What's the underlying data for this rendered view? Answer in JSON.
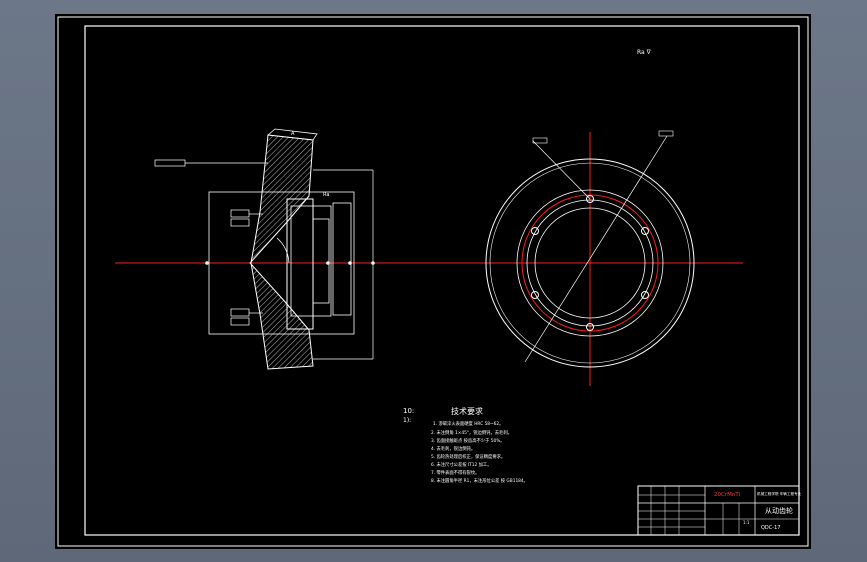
{
  "drawing": {
    "roughness_mark": "Ra",
    "datum_box": "A",
    "notes_roman": "10:",
    "notes_marker": "1):",
    "notes_title": "技术要求",
    "notes": [
      "1. 渗碳淬火表面硬度 HRC 58~62。",
      "2. 未注倒角 1×45°，锐边倒钝，去毛刺。",
      "3. 齿面接触斑点 按齿高不少于 50%。",
      "4. 去毛刺，锐边倒钝。",
      "5. 齿轮热处理后校正，保证精度要求。",
      "6. 未注尺寸公差按 IT12 加工。",
      "7. 零件表面不得有裂纹。",
      "8. 未注圆角半径 R1，未注形位公差 按 GB1184。"
    ],
    "title_block": {
      "material": "20CrMnTi",
      "school": "机械工程学院 车辆工程专业",
      "part_name": "从动齿轮",
      "drawing_no": "QDC-17",
      "scale": "1:1"
    }
  }
}
